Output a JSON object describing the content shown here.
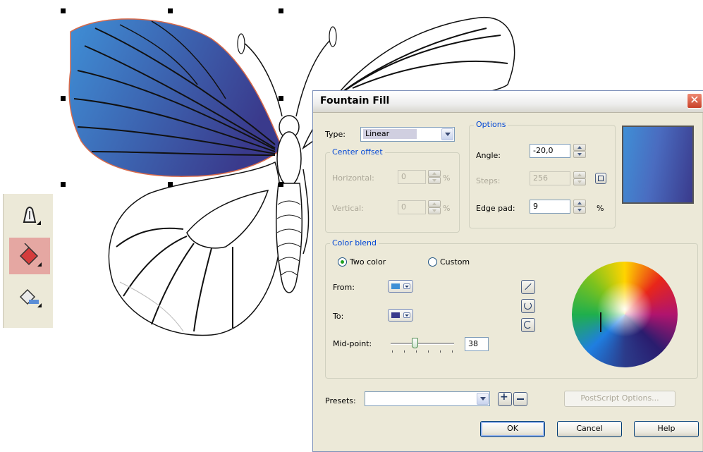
{
  "dialog": {
    "title": "Fountain Fill",
    "close_icon": "close-icon"
  },
  "type_section": {
    "label": "Type:",
    "value": "Linear"
  },
  "center_offset": {
    "title": "Center offset",
    "horizontal_label": "Horizontal:",
    "horizontal_value": "0",
    "vertical_label": "Vertical:",
    "vertical_value": "0",
    "unit": "%"
  },
  "options": {
    "title": "Options",
    "angle_label": "Angle:",
    "angle_value": "-20,0",
    "steps_label": "Steps:",
    "steps_value": "256",
    "edge_pad_label": "Edge pad:",
    "edge_pad_value": "9",
    "edge_pad_unit": "%"
  },
  "color_blend": {
    "title": "Color blend",
    "two_color_label": "Two color",
    "custom_label": "Custom",
    "selected": "two_color",
    "from_label": "From:",
    "from_color": "#3f8fd6",
    "to_label": "To:",
    "to_color": "#3a3a8c",
    "midpoint_label": "Mid-point:",
    "midpoint_value": "38"
  },
  "presets": {
    "label": "Presets:",
    "value": "",
    "postscript_label": "PostScript Options..."
  },
  "buttons": {
    "ok": "OK",
    "cancel": "Cancel",
    "help": "Help"
  },
  "colors": {
    "wing_from": "#3f8fd6",
    "wing_to": "#3a3a8c",
    "selection_handle": "#000000",
    "active_tool": "#e5a7a2",
    "group_title": "#0046d5"
  },
  "toolbox": {
    "tools": [
      "pen-tool-icon",
      "fill-bucket-icon",
      "interactive-fill-icon"
    ]
  }
}
